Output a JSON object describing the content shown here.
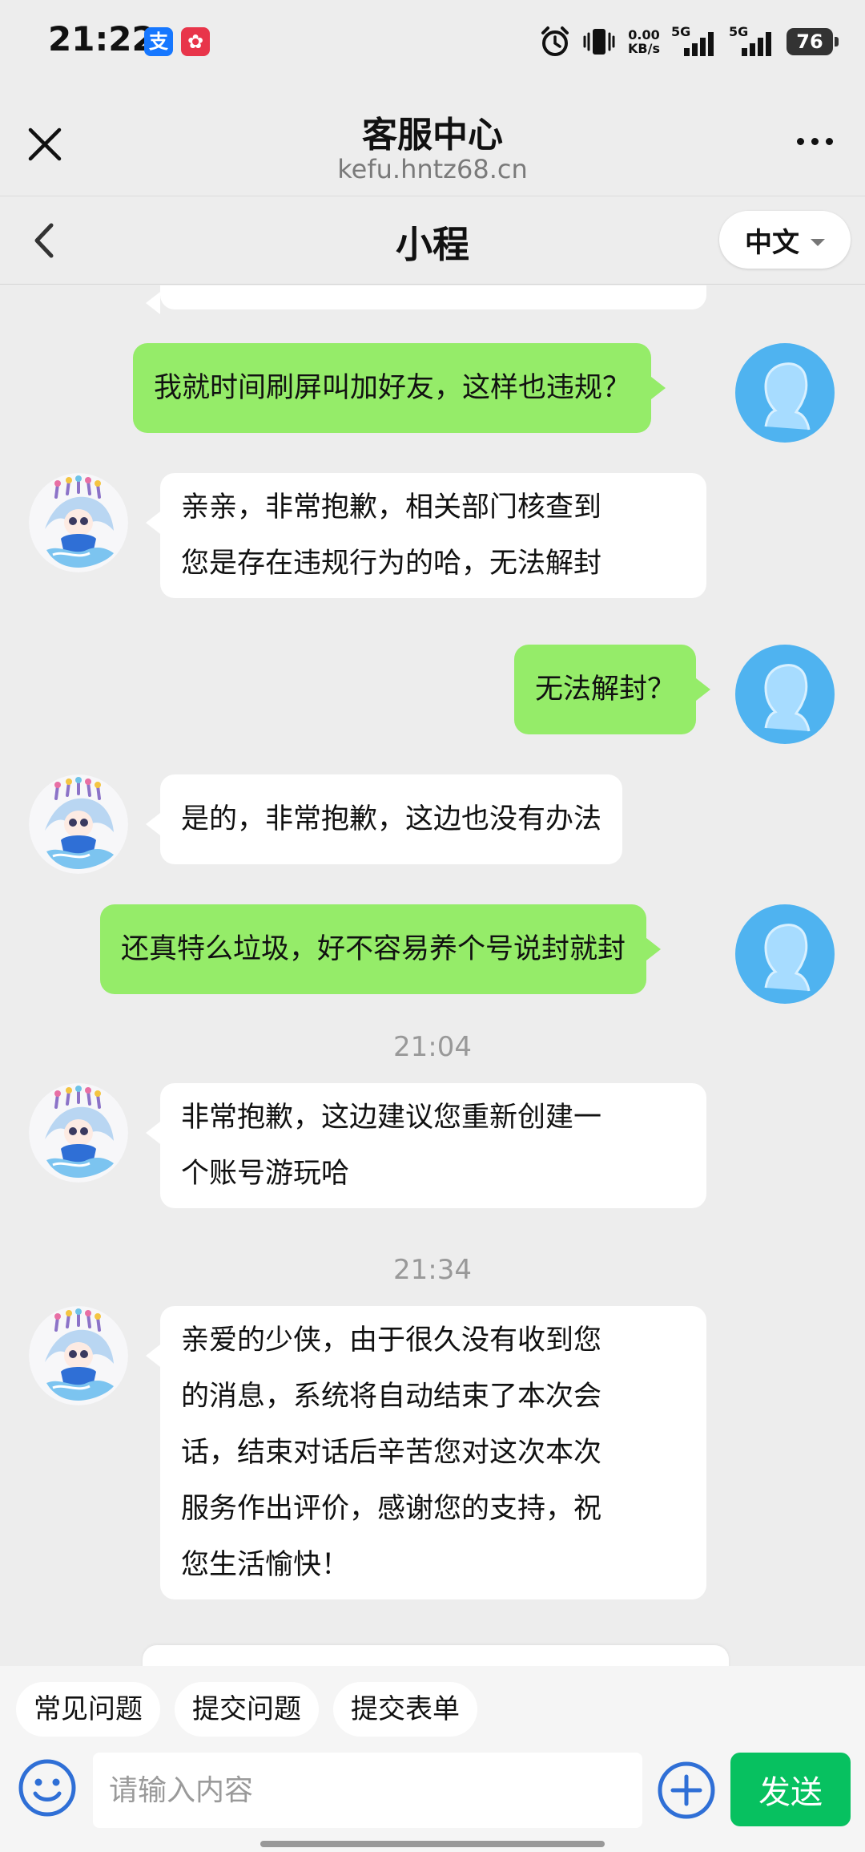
{
  "status_bar": {
    "time": "21:22",
    "app_icons": [
      {
        "name": "alipay-icon",
        "glyph": "支",
        "color": "#1677ff"
      },
      {
        "name": "notification-app-icon",
        "glyph": "✿",
        "color": "#e8354a"
      }
    ],
    "net_speed_value": "0.00",
    "net_speed_unit": "KB/s",
    "signal_labels": [
      "5G",
      "5G"
    ],
    "battery": "76"
  },
  "browser": {
    "title": "客服中心",
    "url": "kefu.hntz68.cn"
  },
  "chat_header": {
    "title": "小程",
    "language": "中文"
  },
  "messages": [
    {
      "from": "user",
      "text": "我就时间刷屏叫加好友，这样也违规？"
    },
    {
      "from": "agent",
      "lines": [
        "亲亲，非常抱歉，相关部门核查到",
        "您是存在违规行为的哈，无法解封"
      ]
    },
    {
      "from": "user",
      "text": "无法解封？"
    },
    {
      "from": "agent",
      "text": "是的，非常抱歉，这边也没有办法"
    },
    {
      "from": "user",
      "text": "还真特么垃圾，好不容易养个号说封就封"
    },
    {
      "type": "time",
      "text": "21:04"
    },
    {
      "from": "agent",
      "lines": [
        "非常抱歉，这边建议您重新创建一",
        "个账号游玩哈"
      ]
    },
    {
      "type": "time",
      "text": "21:34"
    },
    {
      "from": "agent",
      "lines": [
        "亲爱的少侠，由于很久没有收到您",
        "的消息，系统将自动结束了本次会",
        "话，结束对话后辛苦您对这次本次",
        "服务作出评价，感谢您的支持，祝",
        "您生活愉快！"
      ]
    }
  ],
  "quick_replies": [
    "常见问题",
    "提交问题",
    "提交表单"
  ],
  "input": {
    "placeholder": "请输入内容",
    "value": "",
    "send_label": "发送"
  },
  "colors": {
    "user_bubble": "#95ec69",
    "agent_bubble": "#ffffff",
    "send_button": "#07c160",
    "user_avatar": "#4fb3f0",
    "accent_blue": "#2f6fd6"
  }
}
